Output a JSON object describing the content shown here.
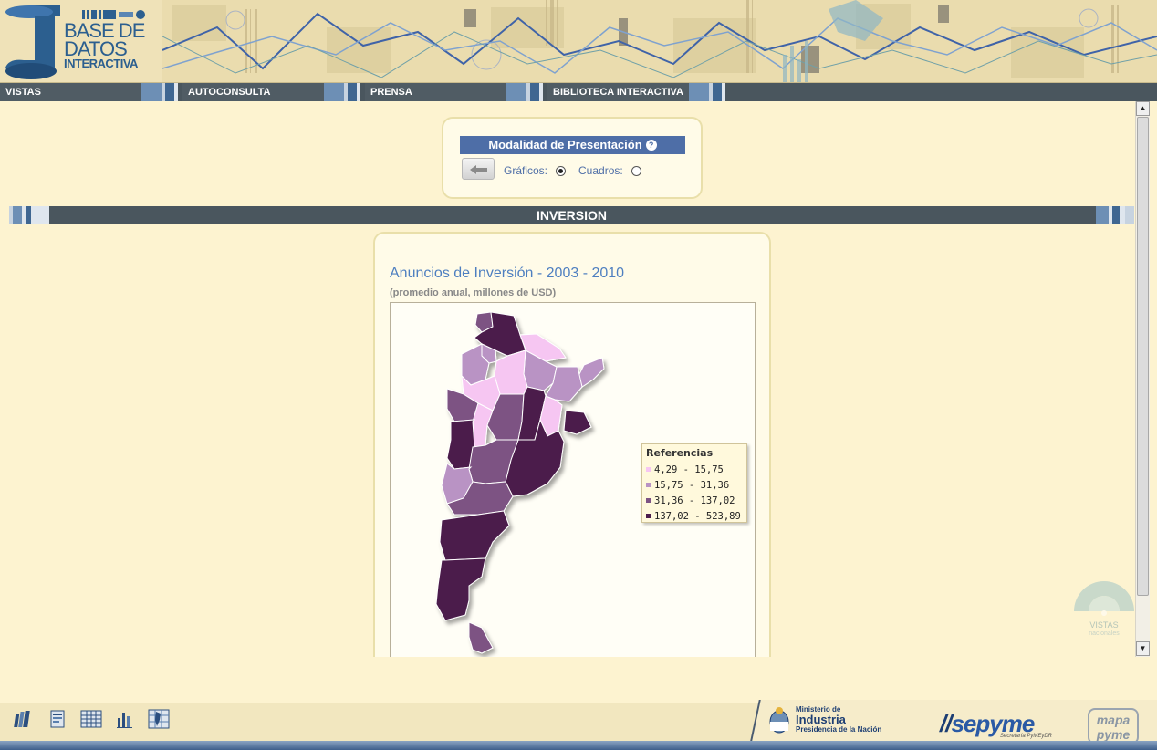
{
  "logo": {
    "line1": "BASE DE",
    "line2": "DATOS",
    "line3": "INTERACTIVA"
  },
  "nav": {
    "items": [
      {
        "label": "VISTAS"
      },
      {
        "label": "AUTOCONSULTA"
      },
      {
        "label": "PRENSA"
      },
      {
        "label": "BIBLIOTECA INTERACTIVA"
      }
    ]
  },
  "modalidad": {
    "title": "Modalidad de Presentación",
    "help_icon": "question-icon",
    "back_icon": "arrow-left-icon",
    "option_graficos": "Gráficos:",
    "option_cuadros": "Cuadros:",
    "selected": "Gráficos"
  },
  "section": {
    "title": "INVERSION"
  },
  "map": {
    "title": "Anuncios de Inversión - 2003 - 2010",
    "subtitle": "(promedio anual, millones de USD)"
  },
  "chart_data": {
    "type": "choropleth",
    "title": "Anuncios de Inversión - 2003 - 2010",
    "subtitle": "(promedio anual, millones de USD)",
    "legend_title": "Referencias",
    "legend_placement": "right",
    "classes": [
      {
        "label": "4,29 - 15,75",
        "min": 4.29,
        "max": 15.75,
        "color": "#f6c6f2"
      },
      {
        "label": "15,75 - 31,36",
        "min": 15.75,
        "max": 31.36,
        "color": "#b993c4"
      },
      {
        "label": "31,36 - 137,02",
        "min": 31.36,
        "max": 137.02,
        "color": "#7d5383"
      },
      {
        "label": "137,02 - 523,89",
        "min": 137.02,
        "max": 523.89,
        "color": "#4b1d4c"
      }
    ]
  },
  "footer": {
    "icons": [
      "books-icon",
      "document-icon",
      "table-icon",
      "bar-chart-icon",
      "map-grid-icon"
    ],
    "ministerio_line1": "Ministerio de",
    "ministerio_line2": "Industria",
    "ministerio_line3": "Presidencia de la Nación",
    "sepyme": "sepyme",
    "sepyme_sub": "Secretaría PyMEyDR",
    "mapa_line1": "mapa",
    "mapa_line2": "pyme"
  },
  "watermark": {
    "line1": "VISTAS",
    "line2": "nacionales"
  },
  "colors": {
    "nav_bg": "#4a565e",
    "accent_blue": "#4e6ea7",
    "title_blue": "#4e7fc0",
    "page_bg": "#fdf3d0"
  }
}
